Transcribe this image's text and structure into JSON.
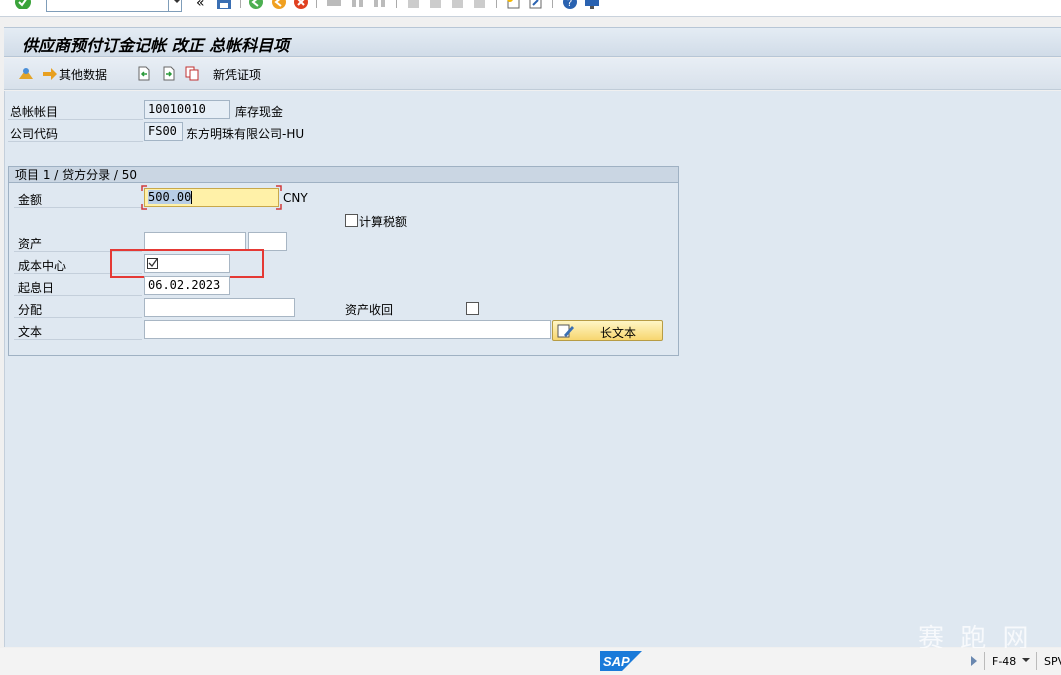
{
  "toolbar": {
    "command_field_value": "",
    "collapse_glyph": "«"
  },
  "title": "供应商预付订金记帐 改正 总帐科目项",
  "app_toolbar": {
    "other_data_label": "其他数据",
    "new_item_label": "新凭证项"
  },
  "header": {
    "gl_account_label": "总帐帐目",
    "gl_account_value": "10010010",
    "gl_account_desc": "库存现金",
    "company_code_label": "公司代码",
    "company_code_value": "FS00",
    "company_code_desc": "东方明珠有限公司-HU"
  },
  "item": {
    "group_title": "项目 1 / 贷方分录 / 50",
    "amount_label": "金额",
    "amount_value": "500.00",
    "currency": "CNY",
    "calc_tax_label": "计算税额",
    "calc_tax_checked": false,
    "asset_label": "资产",
    "asset_value": "",
    "asset_sub_value": "",
    "cost_center_label": "成本中心",
    "cost_center_value": "",
    "value_date_label": "起息日",
    "value_date_value": "06.02.2023",
    "assignment_label": "分配",
    "assignment_value": "",
    "asset_retirement_label": "资产收回",
    "asset_retirement_checked": false,
    "text_label": "文本",
    "text_value": "",
    "long_text_button": "长文本"
  },
  "status_bar": {
    "sap_logo": "SAP",
    "transaction": "F-48",
    "system": "SPV"
  },
  "watermark": "赛 跑 网",
  "colors": {
    "highlight_red": "#e53935",
    "amount_field_bg": "#fff1a8",
    "sap_blue": "#1a7ad9"
  }
}
